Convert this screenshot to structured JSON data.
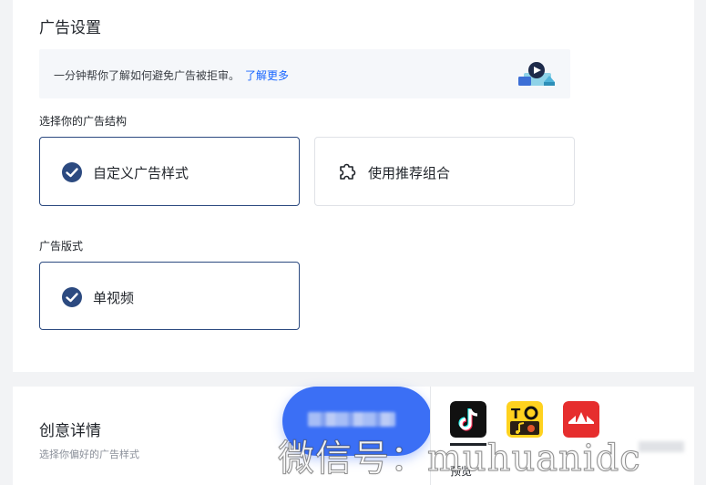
{
  "settings": {
    "title": "广告设置",
    "tip": {
      "text": "一分钟帮你了解如何避免广告被拒审。",
      "link": "了解更多"
    },
    "structure_label": "选择你的广告结构",
    "structure_options": [
      {
        "label": "自定义广告样式",
        "selected": true,
        "icon": "check-circle-icon"
      },
      {
        "label": "使用推荐组合",
        "selected": false,
        "icon": "puzzle-icon"
      }
    ],
    "format_label": "广告版式",
    "format_options": [
      {
        "label": "单视频",
        "selected": true,
        "icon": "check-circle-icon"
      }
    ]
  },
  "creative": {
    "title": "创意详情",
    "subtitle": "选择你偏好的广告样式"
  },
  "preview": {
    "label": "预览",
    "apps": [
      "tiktok-icon",
      "topbuzz-icon",
      "pangle-icon"
    ]
  },
  "watermark": "微信号：muhuanidc",
  "colors": {
    "accent": "#1966ff",
    "selected_border": "#2c4a80",
    "fab": "#3b6ff5"
  }
}
